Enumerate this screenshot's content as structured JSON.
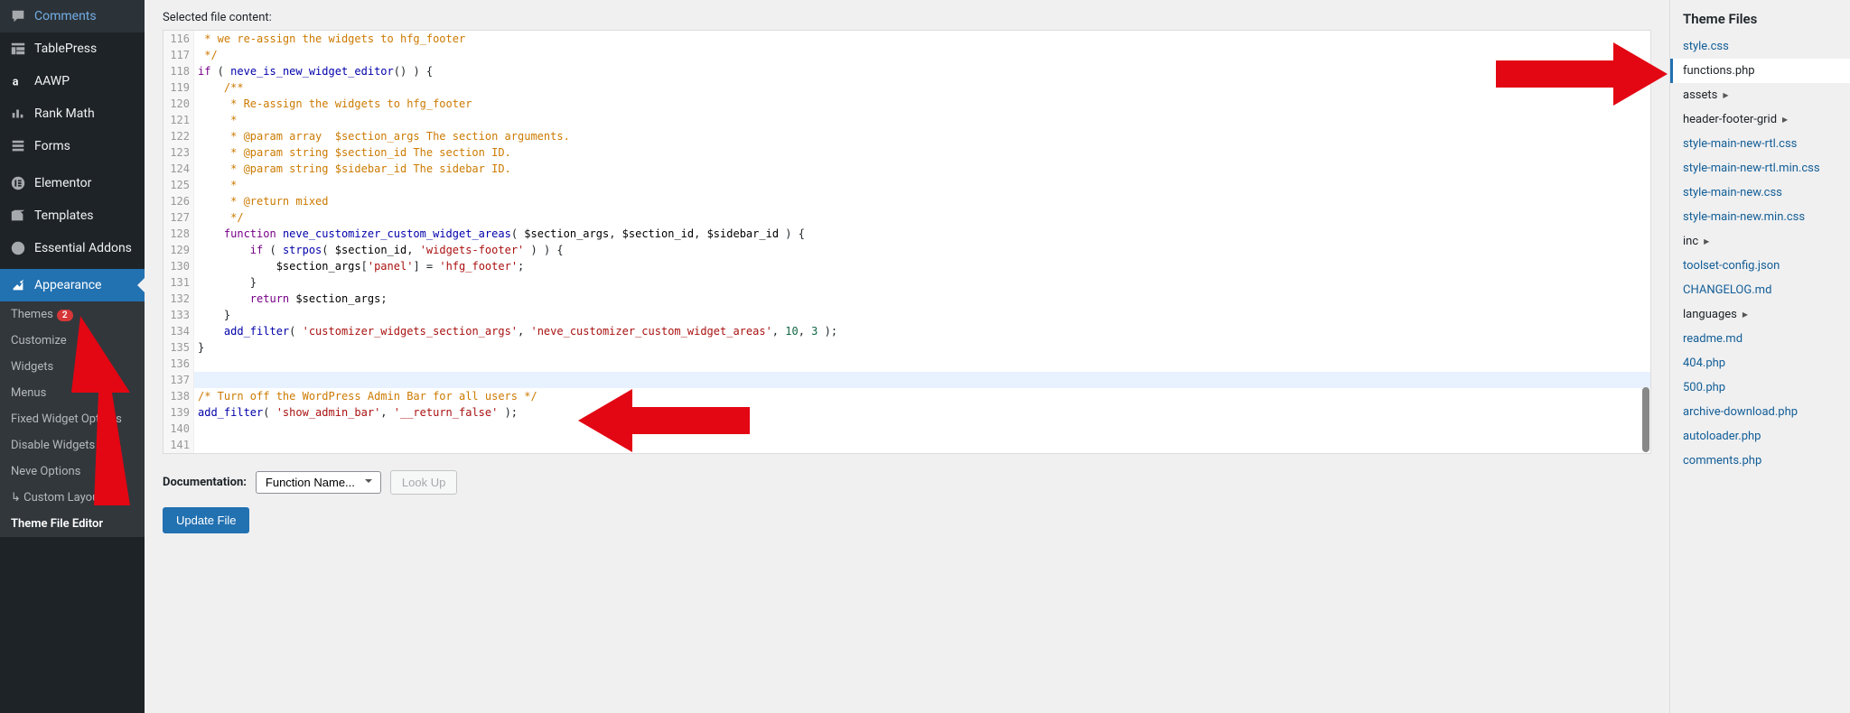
{
  "sidebar": {
    "items": [
      {
        "icon": "comments",
        "label": "Comments"
      },
      {
        "icon": "table",
        "label": "TablePress"
      },
      {
        "icon": "amazon",
        "label": "AAWP"
      },
      {
        "icon": "chart",
        "label": "Rank Math"
      },
      {
        "icon": "forms",
        "label": "Forms"
      },
      {
        "sep": true
      },
      {
        "icon": "elementor",
        "label": "Elementor"
      },
      {
        "icon": "templates",
        "label": "Templates"
      },
      {
        "icon": "addons",
        "label": "Essential Addons"
      },
      {
        "sep": true
      },
      {
        "icon": "appearance",
        "label": "Appearance",
        "current": true
      }
    ],
    "submenu": [
      {
        "label": "Themes",
        "badge": "2"
      },
      {
        "label": "Customize"
      },
      {
        "label": "Widgets"
      },
      {
        "label": "Menus"
      },
      {
        "label": "Fixed Widget Options"
      },
      {
        "label": "Disable Widgets"
      },
      {
        "label": "Neve Options"
      },
      {
        "label": "↳ Custom Layouts"
      },
      {
        "label": "Theme File Editor",
        "active": true
      }
    ]
  },
  "main": {
    "selected_label": "Selected file content:",
    "doc_label": "Documentation:",
    "func_placeholder": "Function Name...",
    "lookup": "Look Up",
    "update": "Update File"
  },
  "code": {
    "start": 116,
    "lines": [
      {
        "html": "<span class='c-com'> * we re-assign the widgets to hfg_footer</span>"
      },
      {
        "html": "<span class='c-com'> */</span>"
      },
      {
        "html": "<span class='c-kw'>if</span> ( <span class='c-fn'>neve_is_new_widget_editor</span>() ) {"
      },
      {
        "html": "    <span class='c-com'>/**</span>"
      },
      {
        "html": "<span class='c-com'>     * Re-assign the widgets to hfg_footer</span>"
      },
      {
        "html": "<span class='c-com'>     *</span>"
      },
      {
        "html": "<span class='c-com'>     * @param array  $section_args The section arguments.</span>"
      },
      {
        "html": "<span class='c-com'>     * @param string $section_id The section ID.</span>"
      },
      {
        "html": "<span class='c-com'>     * @param string $sidebar_id The sidebar ID.</span>"
      },
      {
        "html": "<span class='c-com'>     *</span>"
      },
      {
        "html": "<span class='c-com'>     * @return mixed</span>"
      },
      {
        "html": "<span class='c-com'>     */</span>"
      },
      {
        "html": "    <span class='c-kw'>function</span> <span class='c-fn'>neve_customizer_custom_widget_areas</span>( <span class='c-var'>$section_args</span>, <span class='c-var'>$section_id</span>, <span class='c-var'>$sidebar_id</span> ) {"
      },
      {
        "html": "        <span class='c-kw'>if</span> ( <span class='c-fn'>strpos</span>( <span class='c-var'>$section_id</span>, <span class='c-str'>'widgets-footer'</span> ) ) {"
      },
      {
        "html": "            <span class='c-var'>$section_args</span>[<span class='c-str'>'panel'</span>] = <span class='c-str'>'hfg_footer'</span>;"
      },
      {
        "html": "        }"
      },
      {
        "html": "        <span class='c-kw'>return</span> <span class='c-var'>$section_args</span>;"
      },
      {
        "html": "    }"
      },
      {
        "html": "    <span class='c-fn'>add_filter</span>( <span class='c-str'>'customizer_widgets_section_args'</span>, <span class='c-str'>'neve_customizer_custom_widget_areas'</span>, <span class='c-num'>10</span>, <span class='c-num'>3</span> );"
      },
      {
        "html": "}"
      },
      {
        "html": ""
      },
      {
        "html": "",
        "active": true
      },
      {
        "html": "<span class='c-com'>/* Turn off the WordPress Admin Bar for all users */</span>"
      },
      {
        "html": "<span class='c-fn'>add_filter</span>( <span class='c-str'>'show_admin_bar'</span>, <span class='c-str'>'__return_false'</span> );"
      },
      {
        "html": ""
      },
      {
        "html": ""
      }
    ]
  },
  "theme_files": {
    "title": "Theme Files",
    "items": [
      {
        "label": "style.css",
        "type": "file"
      },
      {
        "label": "functions.php",
        "type": "file",
        "active": true
      },
      {
        "label": "assets",
        "type": "folder"
      },
      {
        "label": "header-footer-grid",
        "type": "folder"
      },
      {
        "label": "style-main-new-rtl.css",
        "type": "file"
      },
      {
        "label": "style-main-new-rtl.min.css",
        "type": "file"
      },
      {
        "label": "style-main-new.css",
        "type": "file"
      },
      {
        "label": "style-main-new.min.css",
        "type": "file"
      },
      {
        "label": "inc",
        "type": "folder"
      },
      {
        "label": "toolset-config.json",
        "type": "file"
      },
      {
        "label": "CHANGELOG.md",
        "type": "file"
      },
      {
        "label": "languages",
        "type": "folder"
      },
      {
        "label": "readme.md",
        "type": "file"
      },
      {
        "label": "404.php",
        "type": "file"
      },
      {
        "label": "500.php",
        "type": "file"
      },
      {
        "label": "archive-download.php",
        "type": "file"
      },
      {
        "label": "autoloader.php",
        "type": "file"
      },
      {
        "label": "comments.php",
        "type": "file"
      }
    ]
  }
}
